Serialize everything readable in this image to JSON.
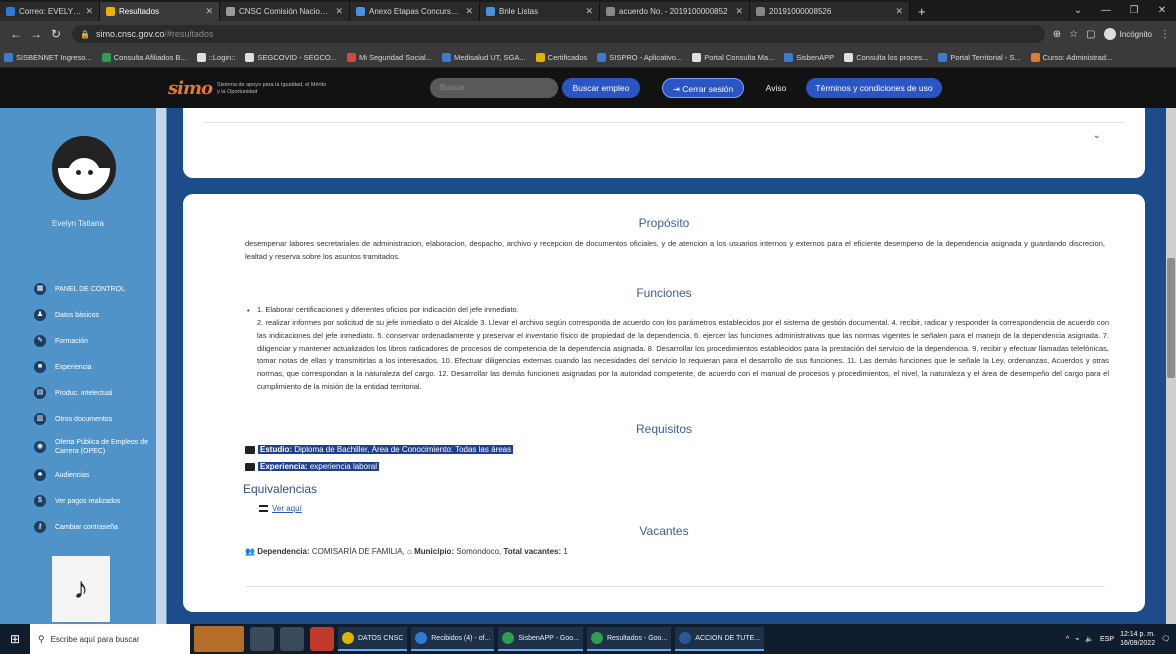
{
  "browser": {
    "tabs": [
      {
        "title": "Correo: EVELYN TATIANA GAITA",
        "color": "#2e7bd6"
      },
      {
        "title": "Resultados",
        "color": "#f0b400"
      },
      {
        "title": "CNSC Comisión Nacional del Se",
        "color": "#9a9a9a"
      },
      {
        "title": "Anexo Etapas Concurso Boyacá",
        "color": "#4a90e2"
      },
      {
        "title": "Bnle Listas",
        "color": "#4a90e2"
      },
      {
        "title": "acuerdo No. - 2019100000852",
        "color": "#888"
      },
      {
        "title": "20191000008526",
        "color": "#888"
      }
    ],
    "url_host": "simo.cnsc.gov.co",
    "url_path": "/#resultados",
    "incognito_label": "Incógnito",
    "bookmarks": [
      {
        "label": "SISBENNET Ingreso...",
        "color": "#3c7bd1"
      },
      {
        "label": "Consulta Afiliados B...",
        "color": "#2e9e4f"
      },
      {
        "label": "::Login::",
        "color": "#e0e0e0"
      },
      {
        "label": "SEGCOVID - SEGCO...",
        "color": "#e0e0e0"
      },
      {
        "label": "Mi Seguridad Social...",
        "color": "#d04b3c"
      },
      {
        "label": "Medisalud UT, SGA...",
        "color": "#3c7bd1"
      },
      {
        "label": "Certificados",
        "color": "#e0b400"
      },
      {
        "label": "SISPRO - Aplicativo...",
        "color": "#3c7bd1"
      },
      {
        "label": "Portal Consulta Ma...",
        "color": "#e0e0e0"
      },
      {
        "label": "SisbenAPP",
        "color": "#3c7bd1"
      },
      {
        "label": "Consulta los proces...",
        "color": "#e0e0e0"
      },
      {
        "label": "Portal Territorial - S...",
        "color": "#3c7bd1"
      },
      {
        "label": "Curso: Administrad...",
        "color": "#e07b2e"
      }
    ]
  },
  "header": {
    "logo_mark": "simo",
    "tagline": "Sistema de apoyo para la Igualdad, el Mérito y la Oportunidad",
    "search_placeholder": "Buscar",
    "buscar_empleo": "Buscar empleo",
    "cerrar_sesion": "Cerrar sesión",
    "aviso": "Aviso",
    "terminos": "Términos y condiciones de uso"
  },
  "sidebar": {
    "user_name": "Evelyn Tatiana",
    "items": [
      {
        "label": "PANEL DE CONTROL",
        "icon": "▦"
      },
      {
        "label": "Datos básicos",
        "icon": "♟"
      },
      {
        "label": "Formación",
        "icon": "✎"
      },
      {
        "label": "Experiencia",
        "icon": "■"
      },
      {
        "label": "Produc. intelectual",
        "icon": "▤"
      },
      {
        "label": "Otros documentos",
        "icon": "▥"
      },
      {
        "label": "Oferta Pública de Empleos de Carrera (OPEC)",
        "icon": "◉"
      },
      {
        "label": "Audiencias",
        "icon": "♣"
      },
      {
        "label": "Ver pagos realizados",
        "icon": "$"
      },
      {
        "label": "Cambiar contraseña",
        "icon": "⚷"
      }
    ]
  },
  "content": {
    "proposito_title": "Propósito",
    "proposito_text": "desempenar labores secretariales de administracion, elaboracion, despacho, archivo y recepcion de documentos oficiales, y de atencion a los usuarios internos y externos para el eficiente desempeno de la dependencia asignada y guardando discrecion, lealtad y reserva sobre los asuntos tramitados.",
    "funciones_title": "Funciones",
    "funciones_first": "1. Elaborar certificaciones y diferentes oficios por indicación del jefe inmediato.",
    "funciones_rest": "2. realizar informes por solicitud de su jefe inmediato o del Alcalde 3. Llevar el archivo según corresponda de acuerdo con los parámetros establecidos por el sistema de gestión documental. 4. recibir, radicar y responder la correspondencia de acuerdo con las indicaciones del jefe inmediato. 5. conservar ordenadamente y preservar el inventario físico de propiedad de la dependencia. 6. ejercer las funciones administrativas que las normas vigentes le señalen para el manejo de la dependencia asignada. 7. diligenciar y mantener actualizados los libros radicadores de procesos de competencia de la dependencia asignada. 8. Desarrollar los procedimientos establecidos para la prestación del servicio de la dependencia. 9. recibir y efectuar llamadas telefónicas, tomar notas de ellas y transmitirlas a los interesados. 10. Efectuar diligencias externas cuando las necesidades del servicio lo requieran para el desarrollo de sus funciones. 11. Las demás funciones que le señale la Ley, ordenanzas, Acuerdos y otras normas, que correspondan a la naturaleza del cargo. 12. Desarrollar las demás funciones asignadas por la autoridad competente, de acuerdo con el manual de procesos y procedimientos, el nivel, la naturaleza y el área de desempeño del cargo para el cumplimiento de la misión de la entidad territorial.",
    "requisitos_title": "Requisitos",
    "estudio_label": "Estudio:",
    "estudio_value": "Diploma de Bachiller, Área de Conocimiento: Todas las áreas",
    "experiencia_label": "Experiencia:",
    "experiencia_value": "experiencia laboral",
    "equivalencias_title": "Equivalencias",
    "ver_aqui": "Ver aquí",
    "vacantes_title": "Vacantes",
    "dependencia_label": "Dependencia:",
    "dependencia_value": "COMISARÍA DE FAMILIA,",
    "municipio_label": "Municipio:",
    "municipio_value": "Somondoco,",
    "total_label": "Total vacantes:",
    "total_value": "1"
  },
  "taskbar": {
    "search_placeholder": "Escribe aquí para buscar",
    "apps": [
      {
        "label": "DATOS CNSC",
        "color": "#e0b400"
      },
      {
        "label": "Recibidos (4) - of...",
        "color": "#2e7bd6"
      },
      {
        "label": "SisbenAPP - Goo...",
        "color": "#2e9e4f"
      },
      {
        "label": "Resultados - Goo...",
        "color": "#2e9e4f"
      },
      {
        "label": "ACCION DE TUTE...",
        "color": "#2b5797"
      }
    ],
    "lang": "ESP",
    "time": "12:14 p. m.",
    "date": "16/09/2022"
  }
}
